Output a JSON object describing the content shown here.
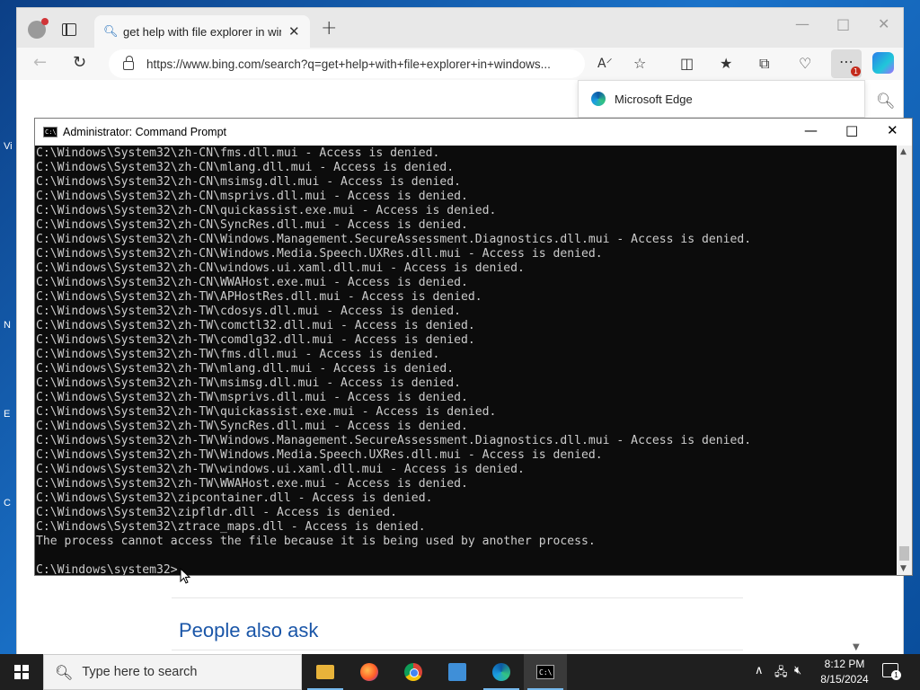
{
  "desktop": {
    "side_letters": [
      "Vi",
      "N",
      "E",
      "C"
    ]
  },
  "browser": {
    "tab_title": "get help with file explorer in windows",
    "address": "https://www.bing.com/search?q=get+help+with+file+explorer+in+windows...",
    "popup_text": "Microsoft Edge",
    "more_badge": "1",
    "page_heading": "People also ask"
  },
  "cmd": {
    "title": "Administrator: Command Prompt",
    "icon_text": "C:\\",
    "lines": [
      "C:\\Windows\\System32\\zh-CN\\fms.dll.mui - Access is denied.",
      "C:\\Windows\\System32\\zh-CN\\mlang.dll.mui - Access is denied.",
      "C:\\Windows\\System32\\zh-CN\\msimsg.dll.mui - Access is denied.",
      "C:\\Windows\\System32\\zh-CN\\msprivs.dll.mui - Access is denied.",
      "C:\\Windows\\System32\\zh-CN\\quickassist.exe.mui - Access is denied.",
      "C:\\Windows\\System32\\zh-CN\\SyncRes.dll.mui - Access is denied.",
      "C:\\Windows\\System32\\zh-CN\\Windows.Management.SecureAssessment.Diagnostics.dll.mui - Access is denied.",
      "C:\\Windows\\System32\\zh-CN\\Windows.Media.Speech.UXRes.dll.mui - Access is denied.",
      "C:\\Windows\\System32\\zh-CN\\windows.ui.xaml.dll.mui - Access is denied.",
      "C:\\Windows\\System32\\zh-CN\\WWAHost.exe.mui - Access is denied.",
      "C:\\Windows\\System32\\zh-TW\\APHostRes.dll.mui - Access is denied.",
      "C:\\Windows\\System32\\zh-TW\\cdosys.dll.mui - Access is denied.",
      "C:\\Windows\\System32\\zh-TW\\comctl32.dll.mui - Access is denied.",
      "C:\\Windows\\System32\\zh-TW\\comdlg32.dll.mui - Access is denied.",
      "C:\\Windows\\System32\\zh-TW\\fms.dll.mui - Access is denied.",
      "C:\\Windows\\System32\\zh-TW\\mlang.dll.mui - Access is denied.",
      "C:\\Windows\\System32\\zh-TW\\msimsg.dll.mui - Access is denied.",
      "C:\\Windows\\System32\\zh-TW\\msprivs.dll.mui - Access is denied.",
      "C:\\Windows\\System32\\zh-TW\\quickassist.exe.mui - Access is denied.",
      "C:\\Windows\\System32\\zh-TW\\SyncRes.dll.mui - Access is denied.",
      "C:\\Windows\\System32\\zh-TW\\Windows.Management.SecureAssessment.Diagnostics.dll.mui - Access is denied.",
      "C:\\Windows\\System32\\zh-TW\\Windows.Media.Speech.UXRes.dll.mui - Access is denied.",
      "C:\\Windows\\System32\\zh-TW\\windows.ui.xaml.dll.mui - Access is denied.",
      "C:\\Windows\\System32\\zh-TW\\WWAHost.exe.mui - Access is denied.",
      "C:\\Windows\\System32\\zipcontainer.dll - Access is denied.",
      "C:\\Windows\\System32\\zipfldr.dll - Access is denied.",
      "C:\\Windows\\System32\\ztrace_maps.dll - Access is denied.",
      "The process cannot access the file because it is being used by another process.",
      "",
      "C:\\Windows\\system32>"
    ]
  },
  "taskbar": {
    "search_placeholder": "Type here to search",
    "time": "8:12 PM",
    "date": "8/15/2024",
    "notification_count": "1"
  }
}
